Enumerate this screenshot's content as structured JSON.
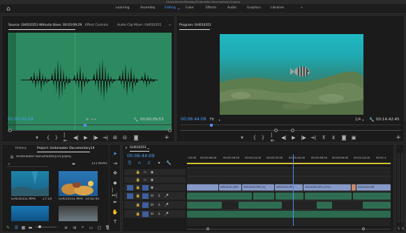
{
  "title_bar": {
    "path": "/Users/ericson/Desktop/Underwater Documentary14.prproj"
  },
  "workspaces": {
    "home": "⌂",
    "tabs": [
      "Learning",
      "Assembly",
      "Editing",
      "Color",
      "Effects",
      "Audio",
      "Graphics",
      "Libraries"
    ],
    "active": "Editing",
    "more": "»"
  },
  "source_panel": {
    "tabs": [
      "Source: GH010351-96Audio Base: 00:03:09:29",
      "Effect Controls",
      "Audio Clip Mixer: GH010351"
    ],
    "timecode_in": "01:00:01:29",
    "timecode_dur": "00:00:09:53",
    "more": "»"
  },
  "program_panel": {
    "tab": "Program: GH010351",
    "timecode": "00:06:44:09",
    "fit": "Fit",
    "ratio": "1/4",
    "duration": "00:14:42:45"
  },
  "project_panel": {
    "tabs": [
      "History",
      "Project: Underwater Documentary14"
    ],
    "project_name": "Underwater Documentary14.prproj",
    "item_count": "111 Items",
    "items": [
      {
        "name": "GH010351.MP4",
        "duration": "27:14"
      },
      {
        "name": "GH010351.MP4",
        "duration": "14:42:45"
      }
    ]
  },
  "timeline": {
    "tab": "GH010351",
    "timecode": "00:06:44:09",
    "ruler": [
      ":00:00",
      "00:00:08:00",
      "00:00:16:00",
      "00:00:24:00",
      "00:00:32:00",
      "00:00:40:00",
      "00:00:48:00",
      "00:00:56:00",
      "00:01:04:00",
      "00:01:1"
    ],
    "tracks": [
      {
        "id": "V3",
        "type": "video"
      },
      {
        "id": "V2",
        "type": "video"
      },
      {
        "id": "V1",
        "type": "video"
      },
      {
        "id": "A1",
        "type": "audio"
      },
      {
        "id": "A2",
        "type": "audio"
      },
      {
        "id": "A3",
        "type": "audio"
      }
    ],
    "video_clips": [
      "GH010351.MP4",
      "GH010394.MP4 [V]",
      "GH010355.MP4",
      "GH010390.MP4 [75%]",
      "GH010349.MP"
    ],
    "playhead_progress": 0.52
  },
  "colors": {
    "accent": "#4ea0ff",
    "source_bg": "#2d8a60",
    "video_clip": "#8598c8",
    "audio_clip": "#2f6d52",
    "playhead": "#4e91f0"
  }
}
